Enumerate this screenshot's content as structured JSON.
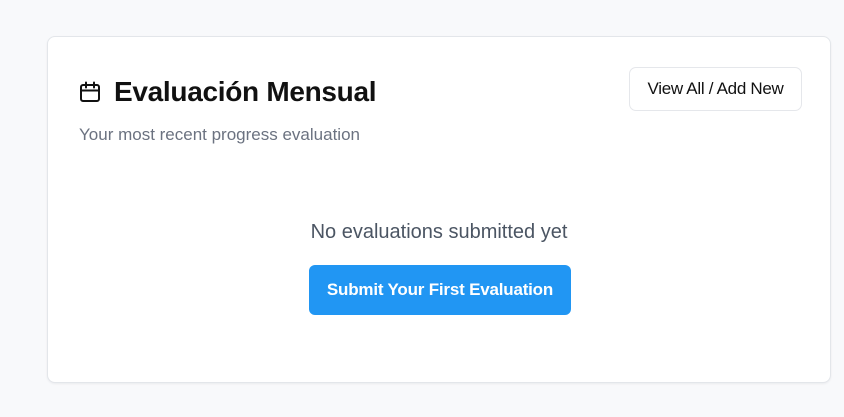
{
  "card": {
    "title": "Evaluación Mensual",
    "title_icon": "calendar-icon",
    "subtitle": "Your most recent progress evaluation",
    "view_all_label": "View All / Add New",
    "empty_message": "No evaluations submitted yet",
    "submit_label": "Submit Your First Evaluation"
  },
  "colors": {
    "page_background": "#f8f9fb",
    "primary_button": "#2196f3",
    "muted_text": "#6b7280"
  }
}
